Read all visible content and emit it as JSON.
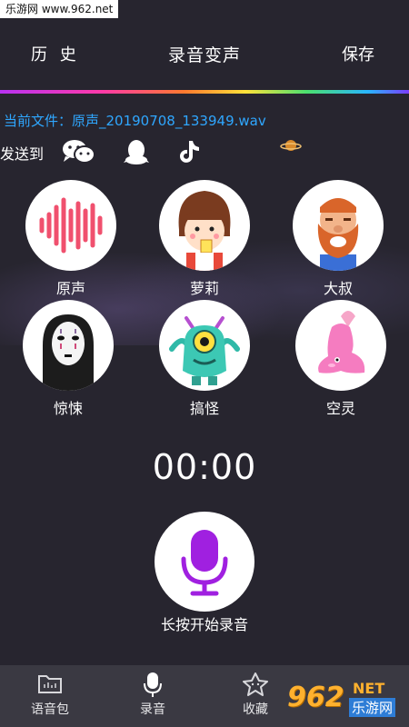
{
  "watermark": {
    "site": "乐游网 www.962.net",
    "logo_number": "962",
    "logo_net": "NET",
    "logo_cn": "乐游网"
  },
  "header": {
    "history": "历 史",
    "title": "录音变声",
    "save": "保存"
  },
  "current_file": "当前文件：原声_20190708_133949.wav",
  "share": {
    "label": "发送到",
    "icons": [
      "wechat-icon",
      "qq-icon",
      "tiktok-icon"
    ]
  },
  "voices": [
    {
      "name": "原声",
      "icon": "sound-wave-icon"
    },
    {
      "name": "萝莉",
      "icon": "girl-avatar-icon"
    },
    {
      "name": "大叔",
      "icon": "bearded-man-avatar-icon"
    },
    {
      "name": "惊悚",
      "icon": "no-face-mask-icon"
    },
    {
      "name": "搞怪",
      "icon": "one-eyed-monster-icon"
    },
    {
      "name": "空灵",
      "icon": "pink-fish-icon"
    }
  ],
  "timer": "00:00",
  "record": {
    "hint": "长按开始录音",
    "icon": "microphone-icon"
  },
  "nav": {
    "items": [
      {
        "label": "语音包",
        "icon": "folder-icon"
      },
      {
        "label": "录音",
        "icon": "microphone-icon"
      },
      {
        "label": "收藏",
        "icon": "star-icon"
      }
    ]
  },
  "colors": {
    "accent_blue": "#2fa7ff",
    "record_purple": "#a020e0",
    "background": "#27252f",
    "nav_bg": "#3a3942"
  }
}
